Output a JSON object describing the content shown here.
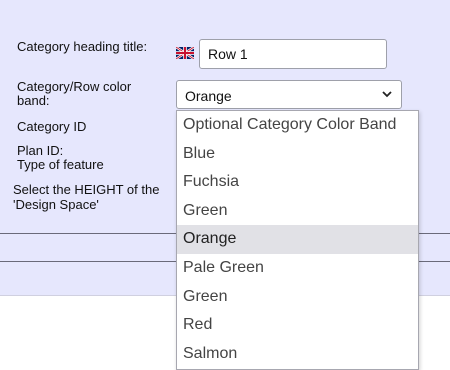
{
  "form": {
    "heading_label": "Category heading title:",
    "heading_value": "Row 1",
    "color_band_label_line1": "Category/Row color",
    "color_band_label_line2": "band:",
    "color_band_selected": "Orange",
    "category_id_label": "Category ID",
    "plan_id_label": "Plan ID:",
    "feature_type_label": "Type of feature",
    "height_label_line1": "Select the HEIGHT of the",
    "height_label_line2": "'Design Space'"
  },
  "dropdown": {
    "options": [
      "Optional Category Color Band",
      "Blue",
      "Fuchsia",
      "Green",
      "Orange",
      "Pale Green",
      "Green",
      "Red",
      "Salmon"
    ],
    "selected_index": 4
  },
  "icons": {
    "flag": "uk-flag-icon",
    "chevron": "chevron-down-icon"
  },
  "colors": {
    "panel_bg": "#e6e7fd",
    "selected_option_bg": "#e1e1e6"
  }
}
